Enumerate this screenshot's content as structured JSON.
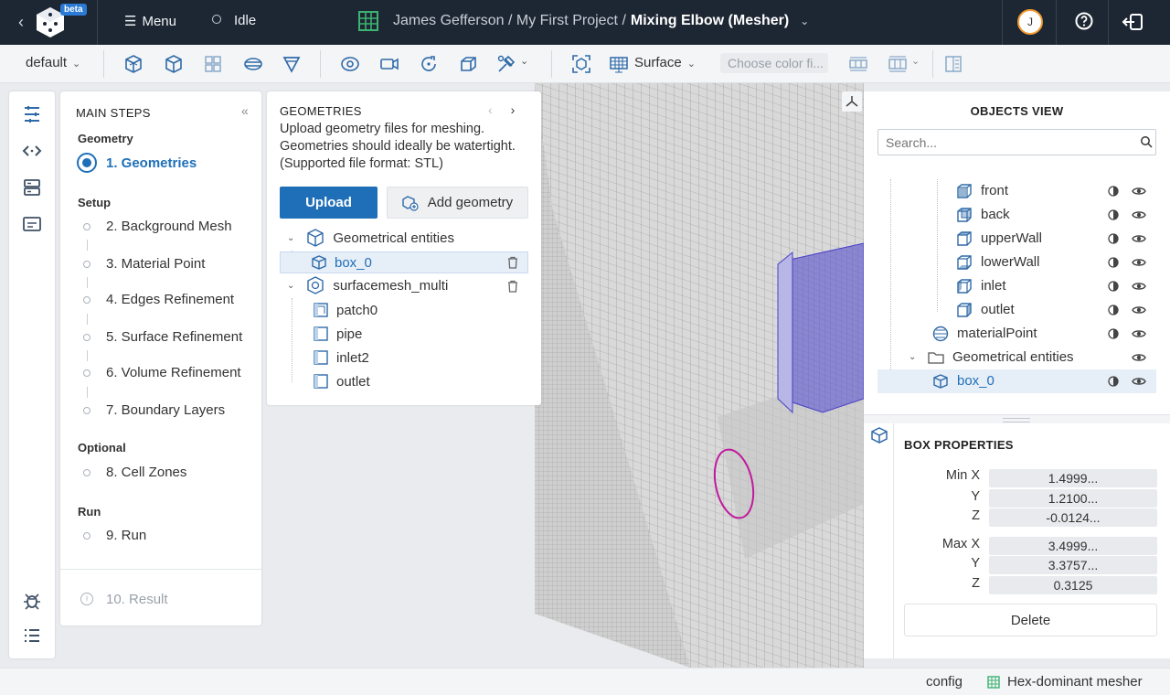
{
  "header": {
    "back_icon": "chevron-left-icon",
    "beta_badge": "beta",
    "menu_label": "Menu",
    "status_label": "Idle",
    "breadcrumb_path": "James Gefferson / My First Project /",
    "breadcrumb_current": "Mixing Elbow (Mesher)",
    "avatar_initial": "J"
  },
  "toolbar": {
    "preset_select": "default",
    "render_mode_select": "Surface",
    "color_field_placeholder": "Choose color fi..."
  },
  "steps": {
    "title": "MAIN STEPS",
    "collapse_icon": "«",
    "groups": {
      "geometry": "Geometry",
      "setup": "Setup",
      "optional": "Optional",
      "run": "Run"
    },
    "items": [
      "1. Geometries",
      "2. Background Mesh",
      "3. Material Point",
      "4. Edges Refinement",
      "5. Surface Refinement",
      "6. Volume Refinement",
      "7. Boundary Layers",
      "8. Cell Zones",
      "9. Run",
      "10. Result"
    ]
  },
  "geometries": {
    "title": "GEOMETRIES",
    "description": "Upload geometry files for meshing. Geometries should ideally be watertight. (Supported file format: STL)",
    "upload_label": "Upload",
    "add_label": "Add geometry",
    "tree": {
      "group1": "Geometrical entities",
      "group1_child": "box_0",
      "group2": "surfacemesh_multi",
      "group2_children": [
        "patch0",
        "pipe",
        "inlet2",
        "outlet"
      ]
    }
  },
  "objects": {
    "title": "OBJECTS VIEW",
    "search_placeholder": "Search...",
    "rows": [
      "front",
      "back",
      "upperWall",
      "lowerWall",
      "inlet",
      "outlet",
      "materialPoint",
      "Geometrical entities",
      "box_0"
    ]
  },
  "properties": {
    "title": "BOX PROPERTIES",
    "labels": {
      "min_x": "Min X",
      "y": "Y",
      "z": "Z",
      "max_x": "Max X"
    },
    "min": {
      "x": "1.4999...",
      "y": "1.2100...",
      "z": "-0.0124..."
    },
    "max": {
      "x": "3.4999...",
      "y": "3.3757...",
      "z": "0.3125"
    },
    "delete_label": "Delete"
  },
  "statusbar": {
    "config": "config",
    "mesher": "Hex-dominant mesher"
  },
  "colors": {
    "accent": "#1f6fb8",
    "topbar": "#1d2733",
    "selected_box": "#7b6fd8",
    "circle": "#c0199c"
  }
}
